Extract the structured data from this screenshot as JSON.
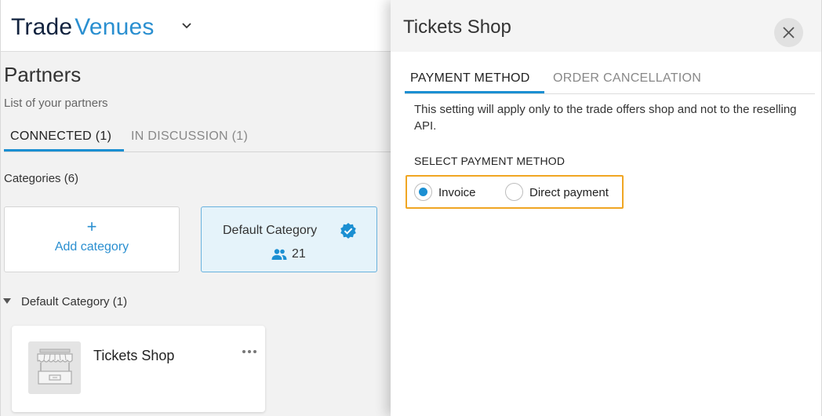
{
  "header": {
    "logo_trade": "Trade",
    "logo_venues": "Venues",
    "logo_color_dark": "#12233f",
    "logo_color_accent": "#2a8fd0"
  },
  "page": {
    "title": "Partners",
    "subtitle": "List of your partners",
    "tabs": [
      {
        "label": "CONNECTED (1)",
        "active": true
      },
      {
        "label": "IN DISCUSSION (1)",
        "active": false
      }
    ],
    "categories_label": "Categories (6)",
    "add_category_plus": "+",
    "add_category_label": "Add category",
    "default_category": {
      "name": "Default Category",
      "count": "21",
      "verified": true
    },
    "group_label": "Default Category (1)",
    "partner": {
      "name": "Tickets Shop",
      "icon": "shop-icon",
      "menu_icon": "more-icon"
    }
  },
  "drawer": {
    "title": "Tickets Shop",
    "tabs": [
      {
        "label": "PAYMENT METHOD",
        "active": true
      },
      {
        "label": "ORDER CANCELLATION",
        "active": false
      }
    ],
    "info_text": "This setting will apply only to the trade offers shop and not to the reselling API.",
    "section_label": "SELECT PAYMENT METHOD",
    "options": [
      {
        "label": "Invoice",
        "selected": true
      },
      {
        "label": "Direct payment",
        "selected": false
      }
    ],
    "accent_color": "#1b8fd2",
    "highlight_color": "#f0a623"
  }
}
